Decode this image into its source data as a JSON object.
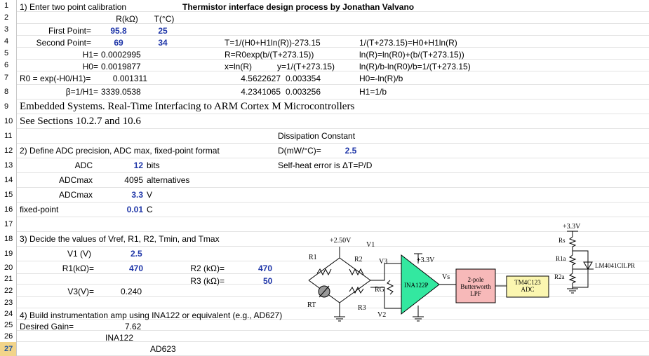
{
  "title": "Thermistor interface design process by Jonathan Valvano",
  "row_numbers": [
    "1",
    "2",
    "3",
    "4",
    "5",
    "6",
    "7",
    "8",
    "9",
    "10",
    "11",
    "12",
    "13",
    "14",
    "15",
    "16",
    "17",
    "18",
    "19",
    "20",
    "21",
    "22",
    "23",
    "24",
    "25",
    "26",
    "27"
  ],
  "section1": {
    "heading": "1) Enter two point calibration",
    "col_r": "R(kΩ)",
    "col_t": "T(°C)",
    "first_label": "First Point=",
    "first_r": "95.8",
    "first_t": "25",
    "second_label": "Second Point=",
    "second_r": "69",
    "second_t": "34",
    "h1_label": "H1=",
    "h1_value": "0.0002995",
    "h0_label": "H0=",
    "h0_value": "0.0019877",
    "r0_label": "R0 = exp(-H0/H1)=",
    "r0_value": "0.001311",
    "beta_label": "β=1/H1=",
    "beta_value": "3339.0538"
  },
  "formulas": {
    "f1": "T=1/(H0+H1ln(R))-273.15",
    "f2": "R=R0exp(b/(T+273.15))",
    "f3a": "x=ln(R)",
    "f3b": "y=1/(T+273.15)",
    "x1": "4.5622627",
    "y1": "0.003354",
    "x2": "4.2341065",
    "y2": "0.003256",
    "g1": "1/(T+273.15)=H0+H1ln(R)",
    "g2": "ln(R)=ln(R0)+(b/(T+273.15))",
    "g3": "ln(R)/b-ln(R0)/b=1/(T+273.15)",
    "g4": "H0=-ln(R)/b",
    "g5": "H1=1/b"
  },
  "book": {
    "line1": "Embedded Systems. Real-Time Interfacing to ARM Cortex M Microcontrollers",
    "line2": "See Sections 10.2.7 and 10.6"
  },
  "dissipation": {
    "heading": "Dissipation Constant",
    "label": "D(mW/°C)=",
    "value": "2.5",
    "note": "Self-heat error is ΔT=P/D"
  },
  "section2": {
    "heading": "2) Define ADC precision, ADC max, fixed-point format",
    "adc_label": "ADC",
    "adc_value": "12",
    "adc_unit": "bits",
    "adcmax1_label": "ADCmax",
    "adcmax1_value": "4095",
    "adcmax1_unit": "alternatives",
    "adcmax2_label": "ADCmax",
    "adcmax2_value": "3.3",
    "adcmax2_unit": "V",
    "fixed_label": "fixed-point",
    "fixed_value": "0.01",
    "fixed_unit": "C"
  },
  "section3": {
    "heading": "3) Decide the values of Vref, R1, R2, Tmin, and Tmax",
    "v1_label": "V1 (V)",
    "v1_value": "2.5",
    "r1_label": "R1(kΩ)=",
    "r1_value": "470",
    "r2_label": "R2 (kΩ)=",
    "r2_value": "470",
    "r3_label": "R3 (kΩ)=",
    "r3_value": "50",
    "v3_label": "V3(V)=",
    "v3_value": "0.240"
  },
  "section4": {
    "heading": "4) Build instrumentation amp using INA122 or equivalent (e.g., AD627)",
    "gain_label": "Desired Gain=",
    "gain_value": "7.62",
    "ina": "INA122",
    "ad": "AD623"
  },
  "circuit": {
    "v_bridge": "+2.50V",
    "v1": "V1",
    "r1": "R1",
    "r2": "R2",
    "v3": "V3",
    "vcc_amp": "+3.3V",
    "amp": "INA122P",
    "rg": "RG",
    "rt": "RT",
    "r3": "R3",
    "v2": "V2",
    "vs": "Vs",
    "filter_line1": "2-pole",
    "filter_line2": "Butterworth",
    "filter_line3": "LPF",
    "mcu_line1": "TM4C123",
    "mcu_line2": "ADC",
    "vref_supply": "+3.3V",
    "rs": "Rs",
    "r1a": "R1a",
    "r2a": "R2a",
    "ref_chip": "LM4041CILPR",
    "colors": {
      "amp_fill": "#33e8a0",
      "filter_fill": "#f7b9b9",
      "mcu_fill": "#fbf6b0"
    }
  }
}
